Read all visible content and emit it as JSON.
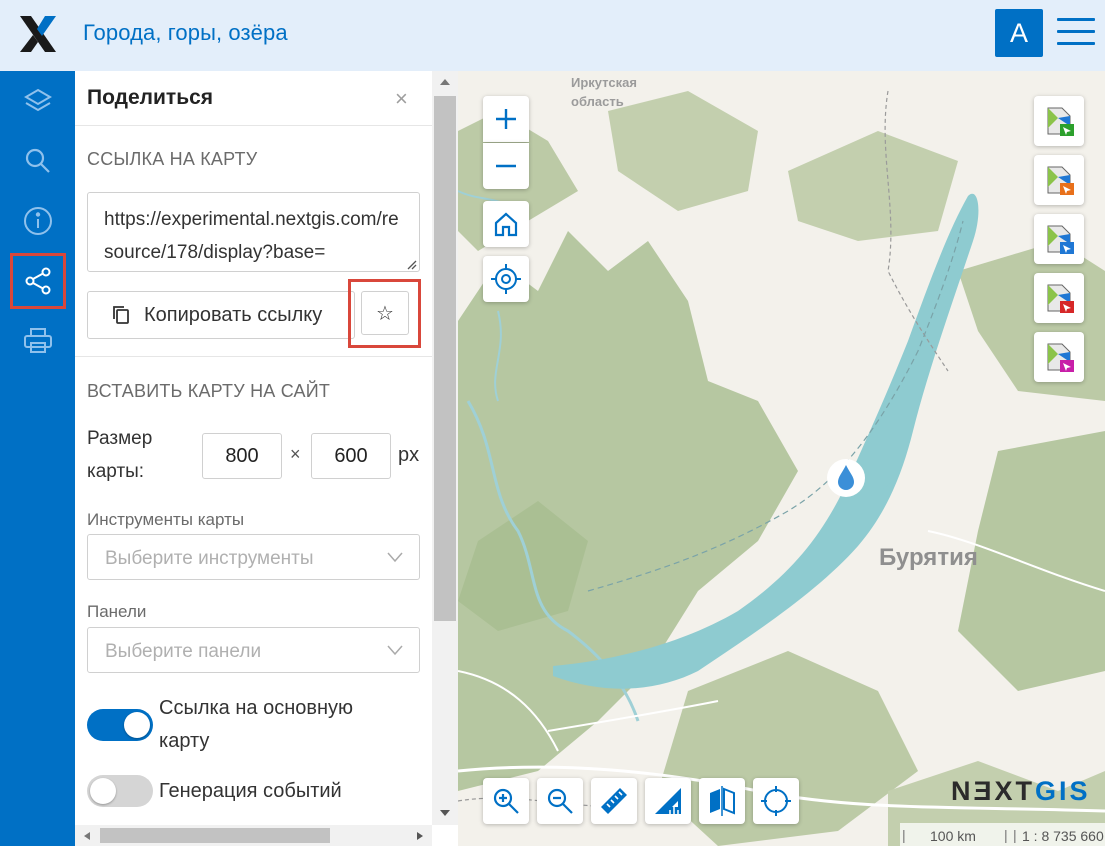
{
  "header": {
    "title": "Города, горы, озёра",
    "avatar_letter": "A",
    "brand_color": "#0070c5"
  },
  "sidebar": {
    "items": [
      {
        "name": "layers-icon"
      },
      {
        "name": "search-icon"
      },
      {
        "name": "info-icon"
      },
      {
        "name": "share-icon",
        "active": true
      },
      {
        "name": "print-icon"
      }
    ]
  },
  "share_panel": {
    "title": "Поделиться",
    "close": "×",
    "link_section": "ССЫЛКА НА КАРТУ",
    "url_value": "https://experimental.nextgis.com/resource/178/display?base=",
    "copy_button": "Копировать ссылку",
    "star": "☆",
    "embed_section": "ВСТАВИТЬ КАРТУ НА САЙТ",
    "size_label_1": "Размер",
    "size_label_2": "карты:",
    "width": "800",
    "times": "×",
    "height": "600",
    "unit": "px",
    "tools_label": "Инструменты карты",
    "tools_placeholder": "Выберите инструменты",
    "panels_label": "Панели",
    "panels_placeholder": "Выберите панели",
    "toggle_main_link_1": "Ссылка на основную",
    "toggle_main_link_2": "карту",
    "toggle_main_link_on": true,
    "toggle_events": "Генерация событий",
    "toggle_events_on": false
  },
  "map": {
    "labels": {
      "region_1": "Иркутская",
      "region_2": "область",
      "buryatia": "Бурятия"
    },
    "brand_left": "N",
    "brand_e": "Ǝ",
    "brand_mid": "XT",
    "brand_gis": "GIS",
    "scale_text": "100 km",
    "ratio_text": "1 : 8 735 660",
    "layer_badge_colors": [
      "#2ca02c",
      "#e8701a",
      "#1f77d4",
      "#d62728",
      "#c81fa8"
    ]
  }
}
